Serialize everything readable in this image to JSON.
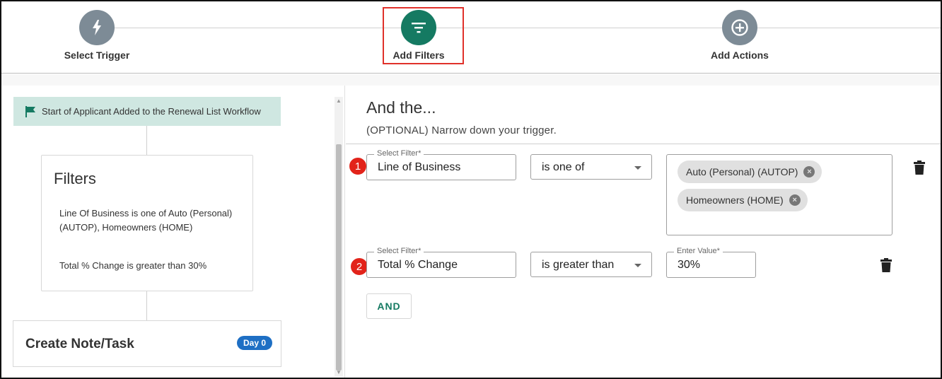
{
  "stepper": {
    "steps": [
      {
        "label": "Select Trigger",
        "icon": "lightning-icon",
        "color": "#7d8b96"
      },
      {
        "label": "Add Filters",
        "icon": "filter-icon",
        "color": "#157a62"
      },
      {
        "label": "Add Actions",
        "icon": "plus-circle-icon",
        "color": "#7d8b96"
      }
    ]
  },
  "workflow": {
    "trigger_text": "Start of Applicant Added to the Renewal List Workflow",
    "filters_card": {
      "title": "Filters",
      "description": "Line Of Business is one of Auto (Personal) (AUTOP), Homeowners (HOME)",
      "description2": "Total % Change is greater than 30%"
    },
    "task_card": {
      "title": "Create Note/Task",
      "badge": "Day 0",
      "badge_color": "#1e6fc4"
    }
  },
  "filters": {
    "heading": "And the...",
    "subheading": "(OPTIONAL) Narrow down your trigger.",
    "rows": [
      {
        "number": "1",
        "filter_label": "Select Filter*",
        "filter_value": "Line of Business",
        "operator": "is one of",
        "chips": [
          "Auto (Personal) (AUTOP)",
          "Homeowners (HOME)"
        ]
      },
      {
        "number": "2",
        "filter_label": "Select Filter*",
        "filter_value": "Total % Change",
        "operator": "is greater than",
        "value_label": "Enter Value*",
        "value": "30%"
      }
    ],
    "and_button": "AND"
  },
  "colors": {
    "accent": "#157a62",
    "highlight": "#e0312a",
    "marker": "#e2231a"
  }
}
